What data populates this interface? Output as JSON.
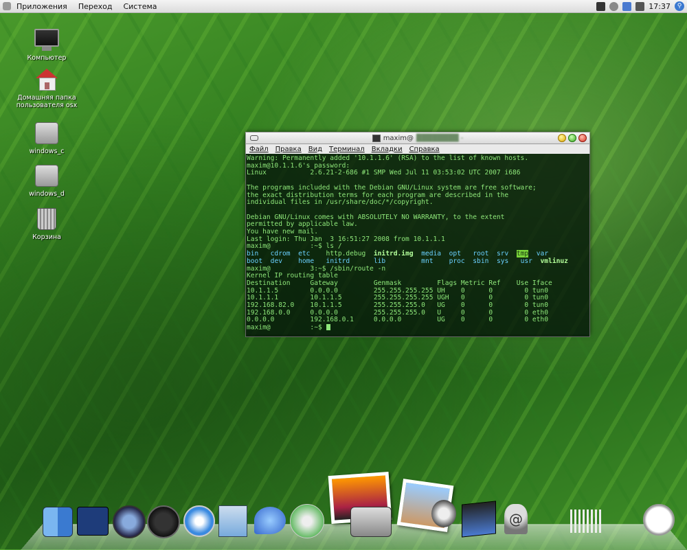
{
  "top_panel": {
    "menus": [
      "Приложения",
      "Переход",
      "Система"
    ],
    "clock": "17:37"
  },
  "desktop_icons": [
    {
      "label": "Компьютер"
    },
    {
      "label": "Домашняя папка\nпользователя osx"
    },
    {
      "label": "windows_c"
    },
    {
      "label": "windows_d"
    },
    {
      "label": "Корзина"
    }
  ],
  "terminal": {
    "title": "maxim@",
    "menu": [
      "Файл",
      "Правка",
      "Вид",
      "Терминал",
      "Вкладки",
      "Справка"
    ],
    "lines": [
      "Warning: Permanently added '10.1.1.6' (RSA) to the list of known hosts.",
      "maxim@10.1.1.6's password:",
      "Linux           2.6.21-2-686 #1 SMP Wed Jul 11 03:53:02 UTC 2007 i686",
      "",
      "The programs included with the Debian GNU/Linux system are free software;",
      "the exact distribution terms for each program are described in the",
      "individual files in /usr/share/doc/*/copyright.",
      "",
      "Debian GNU/Linux comes with ABSOLUTELY NO WARRANTY, to the extent",
      "permitted by applicable law.",
      "You have new mail.",
      "Last login: Thu Jan  3 16:51:27 2008 from 10.1.1.1",
      "maxim@          :~$ ls /"
    ],
    "ls_row1": [
      "bin",
      "cdrom",
      "etc",
      "http.debug",
      "initrd.img",
      "media",
      "opt",
      "root",
      "srv",
      "tmp",
      "var"
    ],
    "ls_row2": [
      "boot",
      "dev",
      "home",
      "initrd",
      "lib",
      "mnt",
      "proc",
      "sbin",
      "sys",
      "usr",
      "vmlinuz"
    ],
    "route_cmd": "maxim@          3:~$ /sbin/route -n",
    "route_title": "Kernel IP routing table",
    "route_header": "Destination     Gateway         Genmask         Flags Metric Ref    Use Iface",
    "route_rows": [
      "10.1.1.5        0.0.0.0         255.255.255.255 UH    0      0        0 tun0",
      "10.1.1.1        10.1.1.5        255.255.255.255 UGH   0      0        0 tun0",
      "192.168.82.0    10.1.1.5        255.255.255.0   UG    0      0        0 tun0",
      "192.168.0.0     0.0.0.0         255.255.255.0   U     0      0        0 eth0",
      "0.0.0.0         192.168.0.1     0.0.0.0         UG    0      0        0 eth0"
    ],
    "prompt": "maxim@          :~$ "
  },
  "dock": {
    "icons": [
      "finder-icon",
      "dashboard-icon",
      "time-machine-icon",
      "gauge-icon",
      "safari-icon",
      "mail-stamp-icon",
      "ichat-icon",
      "itunes-icon",
      "iphoto-icon",
      "camera-icon",
      "photo-icon",
      "preview-icon",
      "imovie-icon",
      "mail-icon",
      "columns-icon",
      "clock-icon"
    ]
  }
}
